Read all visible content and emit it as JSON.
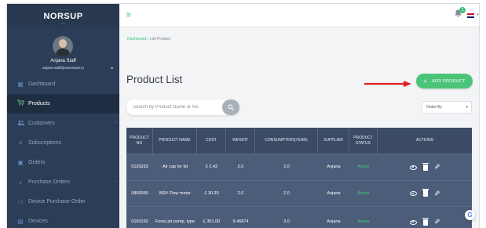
{
  "brand": {
    "top": "~~~~~",
    "name": "NORSUP",
    "sub": "~~~"
  },
  "user": {
    "name": "Anjana Staff",
    "email": "anjana-staff@nuventure.in",
    "chevron": "⌄"
  },
  "sidebar": {
    "items": [
      {
        "label": "Dashboard",
        "icon": "grid-icon",
        "glyph": "▦",
        "active": false,
        "arrow": ""
      },
      {
        "label": "Products",
        "icon": "cart-icon",
        "glyph": "🛒",
        "active": true,
        "arrow": ""
      },
      {
        "label": "Customers",
        "icon": "users-icon",
        "glyph": "👥",
        "active": false,
        "arrow": "›"
      },
      {
        "label": "Subscriptions",
        "icon": "list-icon",
        "glyph": "≡",
        "active": false,
        "arrow": ""
      },
      {
        "label": "Orders",
        "icon": "calendar-icon",
        "glyph": "▣",
        "active": false,
        "arrow": ""
      },
      {
        "label": "Purchase Orders",
        "icon": "basket-icon",
        "glyph": "◒",
        "active": false,
        "arrow": "›"
      },
      {
        "label": "Device Purchase Order",
        "icon": "laptop-icon",
        "glyph": "▭",
        "active": false,
        "arrow": ""
      },
      {
        "label": "Devices",
        "icon": "device-icon",
        "glyph": "▤",
        "active": false,
        "arrow": ""
      }
    ]
  },
  "topbar": {
    "menu_glyph": "≡",
    "notifications": "1",
    "bell_glyph": "🔔",
    "flag_chevron": "▾"
  },
  "breadcrumb": {
    "home": "Dashboard",
    "sep": "›",
    "current": "List Product"
  },
  "page": {
    "title": "Product List",
    "add_button": "ADD PRODUCT",
    "add_glyph": "+",
    "search_placeholder": "Search by Product Name or No.",
    "search_glyph": "⌕",
    "order_by": "Order By",
    "order_chevron": "▾"
  },
  "table": {
    "headers": [
      "PRODUCT NO",
      "PRODUCT NAME",
      "COST",
      "WEIGHT",
      "CONSUMPTION(YEAR)",
      "SUPPLIER",
      "PRODUCT STATUS",
      "ACTIONS"
    ],
    "rows": [
      {
        "no": "0120253",
        "name": "Air cap for lid",
        "cost": "€ 2.42",
        "weight": "2.0",
        "consumption": "2.0",
        "supplier": "Anjana",
        "status": "Active"
      },
      {
        "no": "0800050",
        "name": "BRV Flow meter",
        "cost": "£ 30.30",
        "weight": "2.0",
        "consumption": "2.0",
        "supplier": "Anjana",
        "status": "Active"
      },
      {
        "no": "0150192",
        "name": "Foras jet pump, type",
        "cost": "£ 351.00",
        "weight": "9.46874",
        "consumption": "3.0",
        "supplier": "Anjana",
        "status": "Active"
      }
    ]
  },
  "overlay": {
    "g_glyph": "G"
  },
  "colors": {
    "sidebar": "#2c3d57",
    "accent": "#4bc47a",
    "table_header": "#3b4b66",
    "table_row": "#4c5d7a",
    "arrow": "#e02020"
  }
}
